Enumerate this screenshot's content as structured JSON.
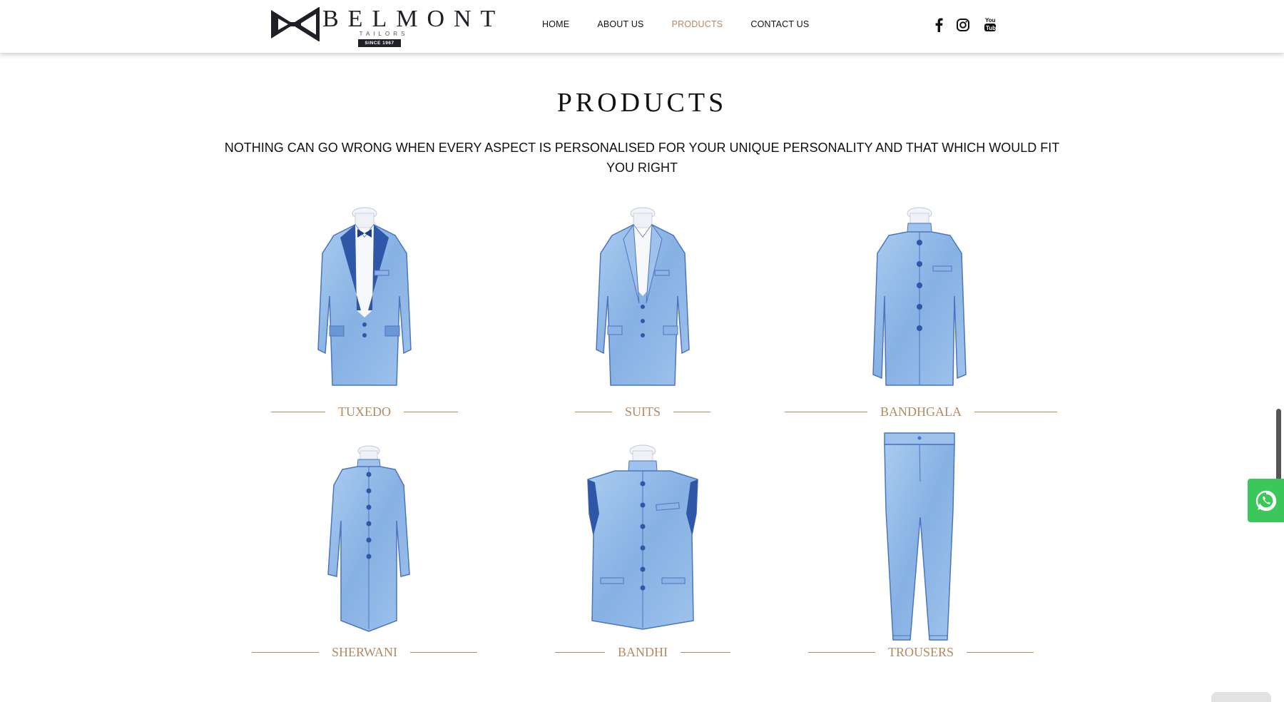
{
  "brand": {
    "name": "BELMONT",
    "subtitle": "TAILORS",
    "since": "SINCE 1967"
  },
  "nav": {
    "items": [
      {
        "label": "HOME",
        "active": false
      },
      {
        "label": "ABOUT US",
        "active": false
      },
      {
        "label": "PRODUCTS",
        "active": true
      },
      {
        "label": "CONTACT US",
        "active": false
      }
    ]
  },
  "social": [
    "facebook-icon",
    "instagram-icon",
    "youtube-icon"
  ],
  "main": {
    "title": "PRODUCTS",
    "subtitle": "NOTHING CAN GO WRONG WHEN EVERY ASPECT IS PERSONALISED FOR YOUR UNIQUE PERSONALITY AND THAT WHICH WOULD FIT YOU RIGHT"
  },
  "products": [
    {
      "label": "TUXEDO",
      "icon": "tuxedo-illustration"
    },
    {
      "label": "SUITS",
      "icon": "suit-illustration"
    },
    {
      "label": "BANDHGALA",
      "icon": "bandhgala-illustration"
    },
    {
      "label": "SHERWANI",
      "icon": "sherwani-illustration"
    },
    {
      "label": "BANDHI",
      "icon": "bandhi-illustration"
    },
    {
      "label": "TROUSERS",
      "icon": "trousers-illustration"
    }
  ],
  "colors": {
    "accent": "#b48a62",
    "garment": "#8fb6e3",
    "garment_dark": "#3f68b6",
    "whatsapp": "#3cc75a"
  }
}
